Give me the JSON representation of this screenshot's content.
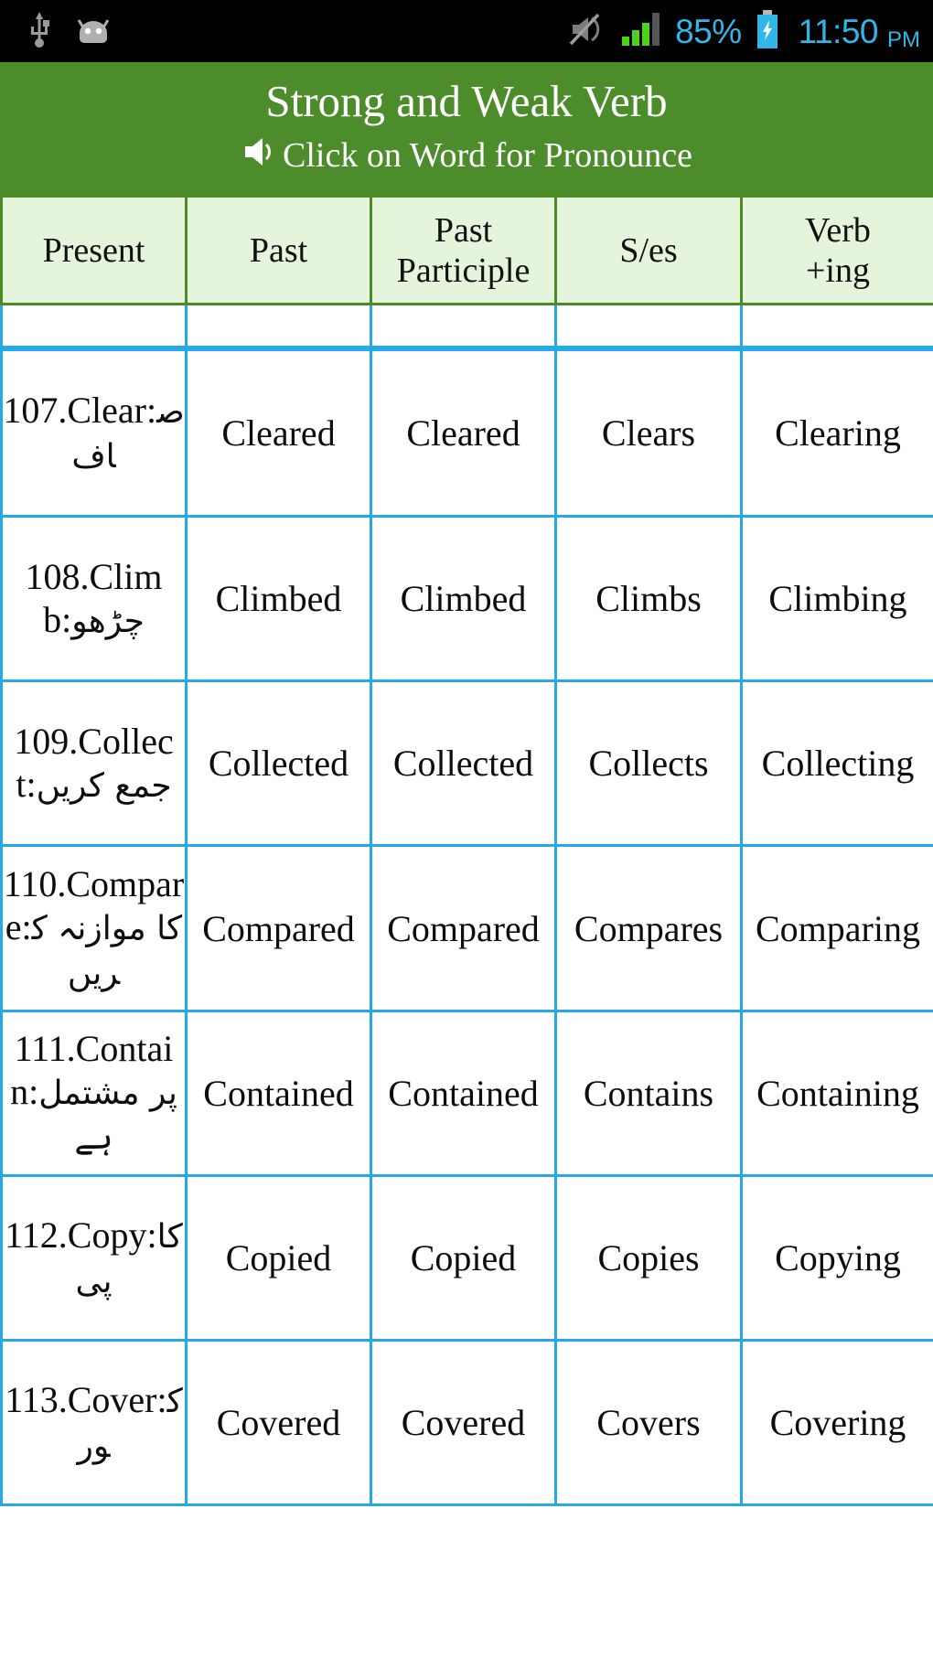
{
  "statusbar": {
    "icons_left": [
      "usb-icon",
      "android-icon"
    ],
    "mute_icon": "volume-muted-icon",
    "signal_icon": "signal-bars-icon",
    "battery_percent": "85%",
    "battery_icon": "battery-charging-icon",
    "time": "11:50",
    "ampm": "PM",
    "accent_color": "#30b6e8",
    "background": "#000000"
  },
  "appbar": {
    "title": "Strong and Weak Verb",
    "subtitle": "Click on Word for Pronounce",
    "speaker_icon": "speaker-icon",
    "background": "#4c8c2b",
    "text_color": "#ffffff"
  },
  "table": {
    "border_color": "#26a9e8",
    "header_bg": "#e4f5dc",
    "header_border": "#4a8a27",
    "headers": [
      "Present",
      "Past",
      "Past Participle",
      "S/es",
      "Verb +ing"
    ],
    "headers_multiline": [
      [
        "Present"
      ],
      [
        "Past"
      ],
      [
        "Past",
        "Participle"
      ],
      [
        "S/es"
      ],
      [
        "Verb",
        "+ing"
      ]
    ],
    "clipped_top_row": {
      "present": "",
      "past": "",
      "past_participle": "",
      "s_es": "",
      "verb_ing": ""
    },
    "rows": [
      {
        "present_en": "107.Clear:",
        "present_ur": "صاف",
        "past": "Cleared",
        "past_participle": "Cleared",
        "s_es": "Clears",
        "verb_ing": "Clearing"
      },
      {
        "present_en": "108.Climb:",
        "present_ur": "چڑھو",
        "past": "Climbed",
        "past_participle": "Climbed",
        "s_es": "Climbs",
        "verb_ing": "Climbing"
      },
      {
        "present_en": "109.Collect:",
        "present_ur": "جمع کریں",
        "past": "Collected",
        "past_participle": "Collected",
        "s_es": "Collects",
        "verb_ing": "Collecting"
      },
      {
        "present_en": "110.Compare:",
        "present_ur": "کا موازنہ کریں",
        "past": "Compared",
        "past_participle": "Compared",
        "s_es": "Compares",
        "verb_ing": "Comparing"
      },
      {
        "present_en": "111.Contain:",
        "present_ur": "پر مشتمل ہے",
        "past": "Contained",
        "past_participle": "Contained",
        "s_es": "Contains",
        "verb_ing": "Containing"
      },
      {
        "present_en": "112.Copy:",
        "present_ur": "کاپی",
        "past": "Copied",
        "past_participle": "Copied",
        "s_es": "Copies",
        "verb_ing": "Copying"
      },
      {
        "present_en": "113.Cover:",
        "present_ur": "کور",
        "past": "Covered",
        "past_participle": "Covered",
        "s_es": "Covers",
        "verb_ing": "Covering"
      }
    ]
  }
}
